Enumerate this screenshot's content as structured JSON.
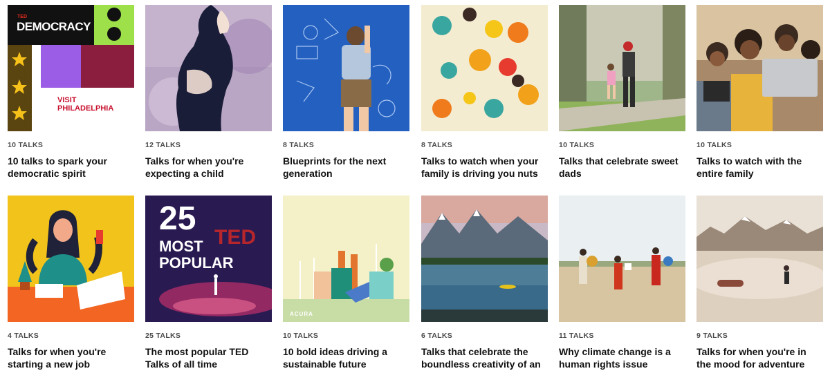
{
  "playlists": [
    {
      "count": "10 TALKS",
      "title": "10 talks to spark your democratic spirit",
      "thumb_text": [
        "TED",
        "DEMOCRACY",
        "VISIT",
        "PHILADELPHIA"
      ]
    },
    {
      "count": "12 TALKS",
      "title": "Talks for when you're expecting a child"
    },
    {
      "count": "8 TALKS",
      "title": "Blueprints for the next generation"
    },
    {
      "count": "8 TALKS",
      "title": "Talks to watch when your family is driving you nuts"
    },
    {
      "count": "10 TALKS",
      "title": "Talks that celebrate sweet dads"
    },
    {
      "count": "10 TALKS",
      "title": "Talks to watch with the entire family"
    },
    {
      "count": "4 TALKS",
      "title": "Talks for when you're starting a new job"
    },
    {
      "count": "25 TALKS",
      "title": "The most popular TED Talks of all time",
      "thumb_text": [
        "25",
        "MOST",
        "POPULAR",
        "TED"
      ]
    },
    {
      "count": "10 TALKS",
      "title": "10 bold ideas driving a sustainable future",
      "thumb_text": [
        "ACURA"
      ]
    },
    {
      "count": "6 TALKS",
      "title": "Talks that celebrate the boundless creativity of an"
    },
    {
      "count": "11 TALKS",
      "title": "Why climate change is a human rights issue"
    },
    {
      "count": "9 TALKS",
      "title": "Talks for when you're in the mood for adventure"
    }
  ],
  "colors": {
    "ted_red": "#e62b1e",
    "text_dark": "#111111",
    "text_muted": "#4a4a4a"
  }
}
